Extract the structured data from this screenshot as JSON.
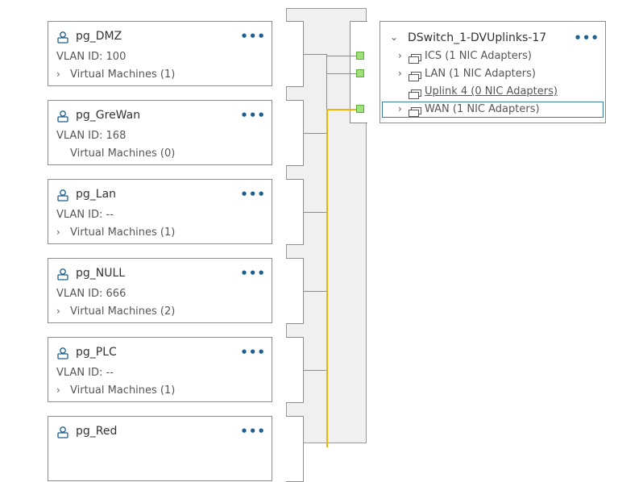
{
  "portgroups": [
    {
      "name": "pg_DMZ",
      "vlan": "VLAN ID: 100",
      "vms": "Virtual Machines (1)",
      "expandable": true
    },
    {
      "name": "pg_GreWan",
      "vlan": "VLAN ID: 168",
      "vms": "Virtual Machines (0)",
      "expandable": false
    },
    {
      "name": "pg_Lan",
      "vlan": "VLAN ID: --",
      "vms": "Virtual Machines (1)",
      "expandable": true
    },
    {
      "name": "pg_NULL",
      "vlan": "VLAN ID: 666",
      "vms": "Virtual Machines (2)",
      "expandable": true
    },
    {
      "name": "pg_PLC",
      "vlan": "VLAN ID: --",
      "vms": "Virtual Machines (1)",
      "expandable": true
    },
    {
      "name": "pg_Red",
      "vlan": "",
      "vms": "",
      "expandable": false
    }
  ],
  "more_label": "•••",
  "chevron_right": "›",
  "chevron_down": "⌄",
  "uplinks": {
    "title": "DSwitch_1-DVUplinks-17",
    "items": [
      {
        "label": "ICS (1 NIC Adapters)",
        "expandable": true,
        "link": false,
        "selected": false
      },
      {
        "label": "LAN (1 NIC Adapters)",
        "expandable": true,
        "link": false,
        "selected": false
      },
      {
        "label": "Uplink 4 (0 NIC Adapters)",
        "expandable": false,
        "link": true,
        "selected": false
      },
      {
        "label": "WAN (1 NIC Adapters)",
        "expandable": true,
        "link": false,
        "selected": true
      }
    ]
  },
  "colors": {
    "accent": "#1d5f8f",
    "active_port": "#9ee07a",
    "active_line": "#f0b400",
    "border": "#8c8c8c"
  },
  "icons": {
    "portgroup": "portgroup-icon",
    "nic": "nic-adapter-icon",
    "more": "more-actions-icon"
  }
}
